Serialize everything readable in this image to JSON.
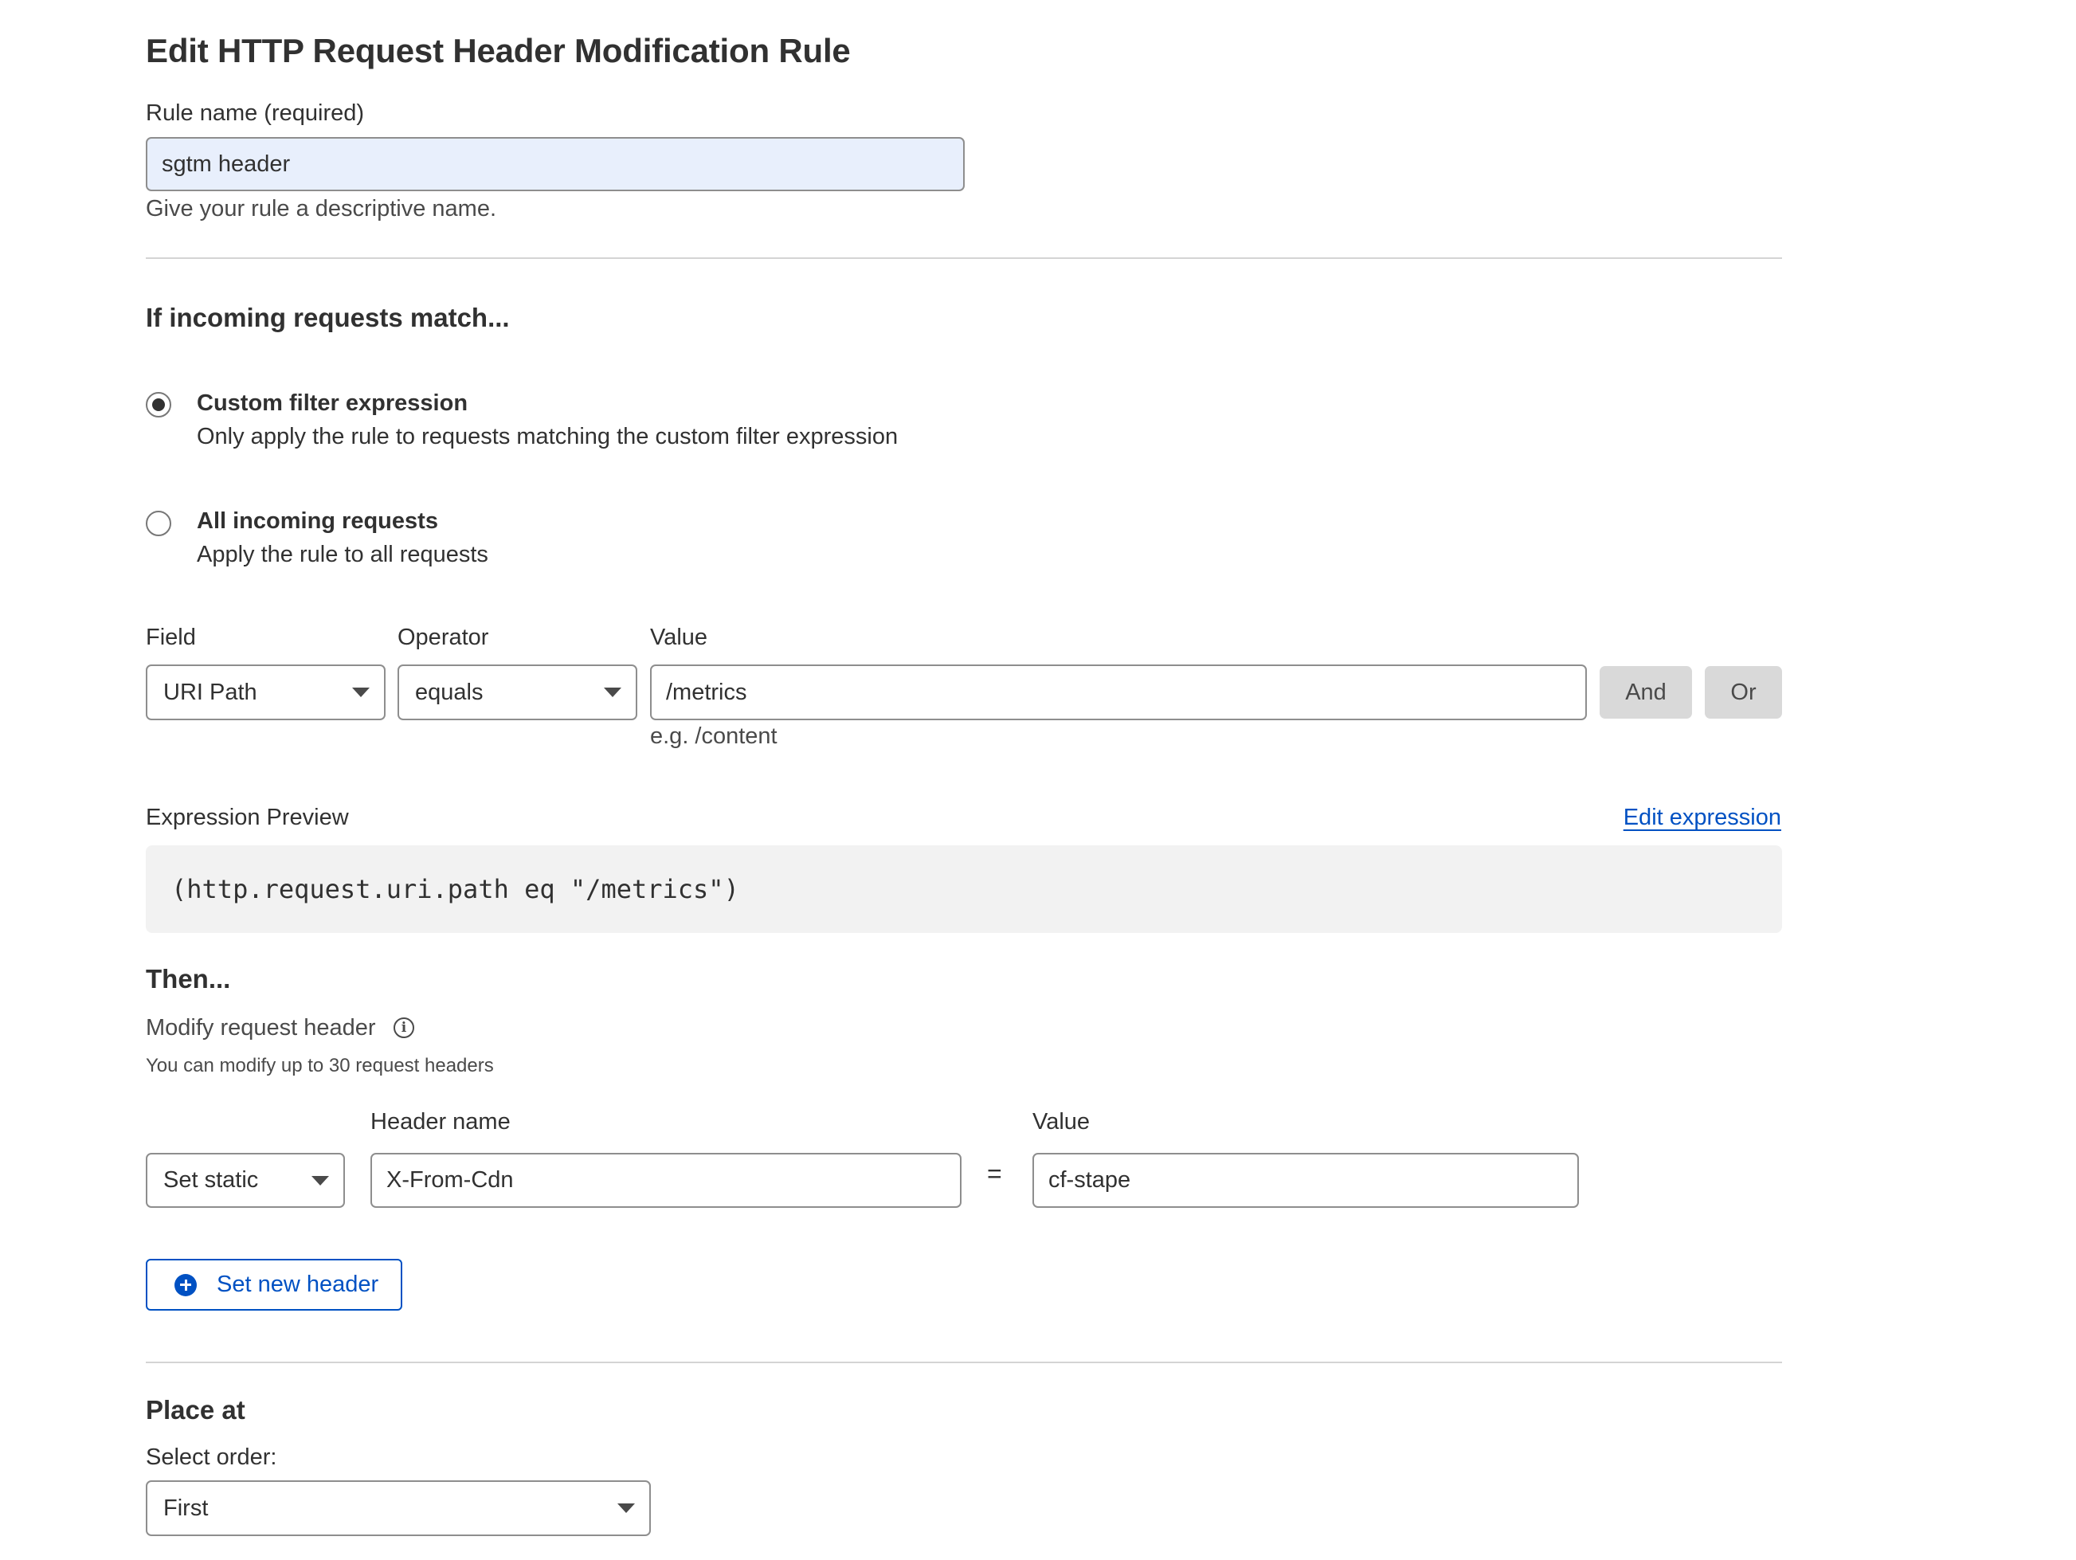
{
  "page": {
    "title": "Edit HTTP Request Header Modification Rule"
  },
  "rule_name": {
    "label": "Rule name (required)",
    "value": "sgtm header",
    "help": "Give your rule a descriptive name."
  },
  "match": {
    "heading": "If incoming requests match...",
    "options": [
      {
        "title": "Custom filter expression",
        "description": "Only apply the rule to requests matching the custom filter expression",
        "selected": true
      },
      {
        "title": "All incoming requests",
        "description": "Apply the rule to all requests",
        "selected": false
      }
    ]
  },
  "filter": {
    "field_label": "Field",
    "field_value": "URI Path",
    "operator_label": "Operator",
    "operator_value": "equals",
    "value_label": "Value",
    "value": "/metrics",
    "value_hint": "e.g. /content",
    "and_label": "And",
    "or_label": "Or"
  },
  "expression": {
    "label": "Expression Preview",
    "edit_link": "Edit expression",
    "preview": "(http.request.uri.path eq \"/metrics\")"
  },
  "then": {
    "heading": "Then...",
    "modify_label": "Modify request header",
    "limit_note": "You can modify up to 30 request headers",
    "action_value": "Set static",
    "header_name_label": "Header name",
    "header_name_value": "X-From-Cdn",
    "equals_sign": "=",
    "value_label": "Value",
    "value": "cf-stape",
    "add_button": "Set new header"
  },
  "place": {
    "heading": "Place at",
    "order_label": "Select order:",
    "order_value": "First"
  },
  "icons": {
    "info": "info-icon",
    "add": "plus-circle-icon",
    "dropdown": "chevron-down-icon"
  },
  "colors": {
    "accent": "#0051c3",
    "input_filled_bg": "#e8effc",
    "preview_bg": "#f2f2f2",
    "grey_button": "#d9d9d9"
  }
}
